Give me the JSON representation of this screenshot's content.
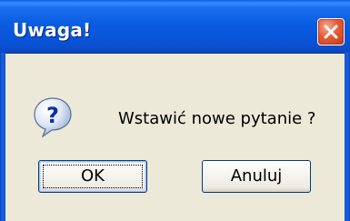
{
  "dialog": {
    "title": "Uwaga!",
    "message": "Wstawić nowe pytanie ?",
    "icon": "question-icon",
    "buttons": {
      "ok_label": "OK",
      "cancel_label": "Anuluj"
    }
  },
  "colors": {
    "titlebar": "#0b5ce0",
    "close_button": "#e65a36",
    "dialog_background": "#ece9d8"
  }
}
